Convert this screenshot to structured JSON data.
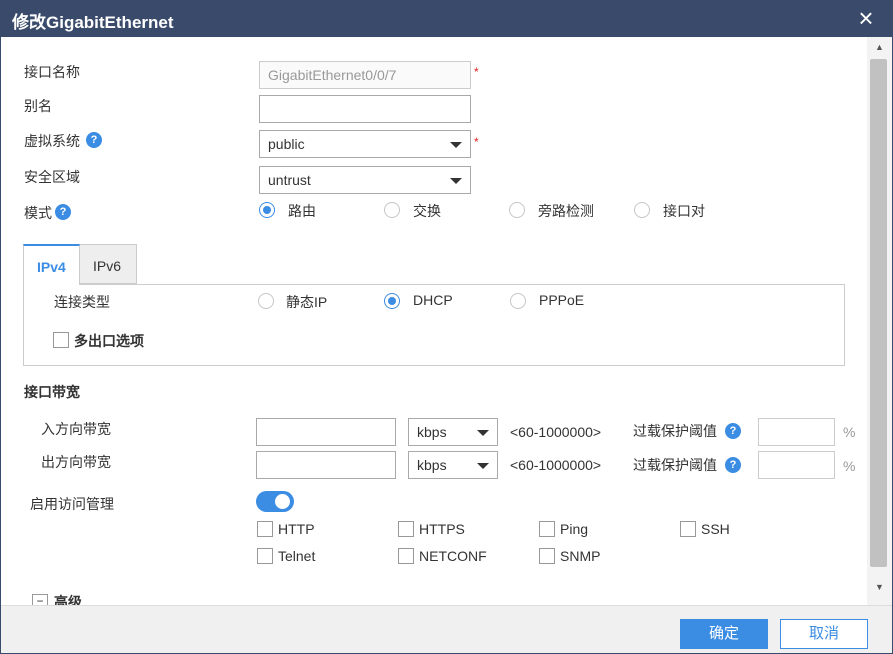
{
  "dialog": {
    "title": "修改GigabitEthernet",
    "close_icon": "×"
  },
  "form": {
    "interface_name": {
      "label": "接口名称",
      "value": "GigabitEthernet0/0/7",
      "required": "*"
    },
    "alias": {
      "label": "别名",
      "value": ""
    },
    "vsys": {
      "label": "虚拟系统",
      "value": "public",
      "required": "*"
    },
    "zone": {
      "label": "安全区域",
      "value": "untrust"
    },
    "mode": {
      "label": "模式",
      "options": [
        "路由",
        "交换",
        "旁路检测",
        "接口对"
      ],
      "selected": "路由"
    }
  },
  "help_icon": "?",
  "tabs": [
    {
      "label": "IPv4",
      "active": true
    },
    {
      "label": "IPv6",
      "active": false
    }
  ],
  "ipv4": {
    "connection_type": {
      "label": "连接类型",
      "options": [
        "静态IP",
        "DHCP",
        "PPPoE"
      ],
      "selected": "DHCP"
    },
    "multi_egress": {
      "label": "多出口选项",
      "checked": false
    }
  },
  "bandwidth": {
    "section_title": "接口带宽",
    "rows": [
      {
        "label": "入方向带宽",
        "value": "",
        "unit": "kbps",
        "range": "<60-1000000>",
        "threshold_label": "过载保护阈值",
        "threshold_value": "",
        "percent": "%"
      },
      {
        "label": "出方向带宽",
        "value": "",
        "unit": "kbps",
        "range": "<60-1000000>",
        "threshold_label": "过载保护阈值",
        "threshold_value": "",
        "percent": "%"
      }
    ]
  },
  "access_management": {
    "label": "启用访问管理",
    "enabled": true,
    "services": [
      {
        "label": "HTTP",
        "checked": false
      },
      {
        "label": "HTTPS",
        "checked": false
      },
      {
        "label": "Ping",
        "checked": false
      },
      {
        "label": "SSH",
        "checked": false
      },
      {
        "label": "Telnet",
        "checked": false
      },
      {
        "label": "NETCONF",
        "checked": false
      },
      {
        "label": "SNMP",
        "checked": false
      }
    ]
  },
  "advanced": {
    "label": "高级",
    "expander_icon": "−"
  },
  "scrollbar": {
    "up_icon": "▲",
    "down_icon": "▼"
  },
  "footer": {
    "ok_label": "确定",
    "cancel_label": "取消"
  },
  "colors": {
    "titlebar": "#3a4a6b",
    "accent": "#3b8ce3",
    "required": "#e02020"
  }
}
